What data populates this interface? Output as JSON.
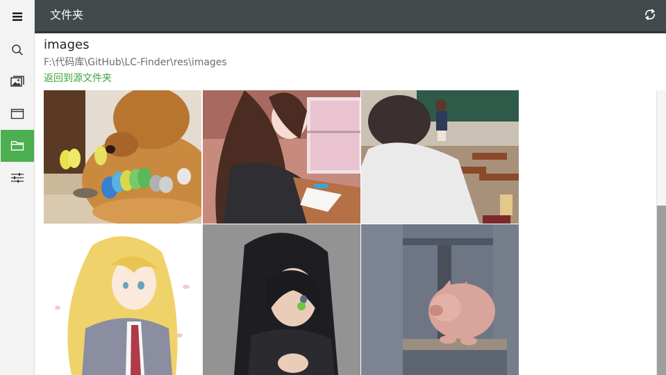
{
  "header": {
    "title": "文件夹"
  },
  "folder": {
    "name": "images",
    "path": "F:\\代码库\\GitHub\\LC-Finder\\res\\images",
    "back_label": "返回到源文件夹"
  },
  "sidebar": {
    "items": [
      {
        "icon": "hamburger-menu-icon"
      },
      {
        "icon": "search-icon"
      },
      {
        "icon": "pictures-icon"
      },
      {
        "icon": "window-icon"
      },
      {
        "icon": "folder-icon",
        "active": true
      },
      {
        "icon": "settings-sliders-icon"
      }
    ]
  },
  "colors": {
    "accent": "#4caf50",
    "header_bg": "#424a4c",
    "link": "#3aa53e"
  },
  "thumbnails": [
    {
      "subject": "dog with parakeets"
    },
    {
      "subject": "anime girl at desk by window"
    },
    {
      "subject": "anime classroom scene"
    },
    {
      "subject": "anime blonde girl"
    },
    {
      "subject": "anime girl in black hoodie"
    },
    {
      "subject": "pig at window"
    }
  ]
}
